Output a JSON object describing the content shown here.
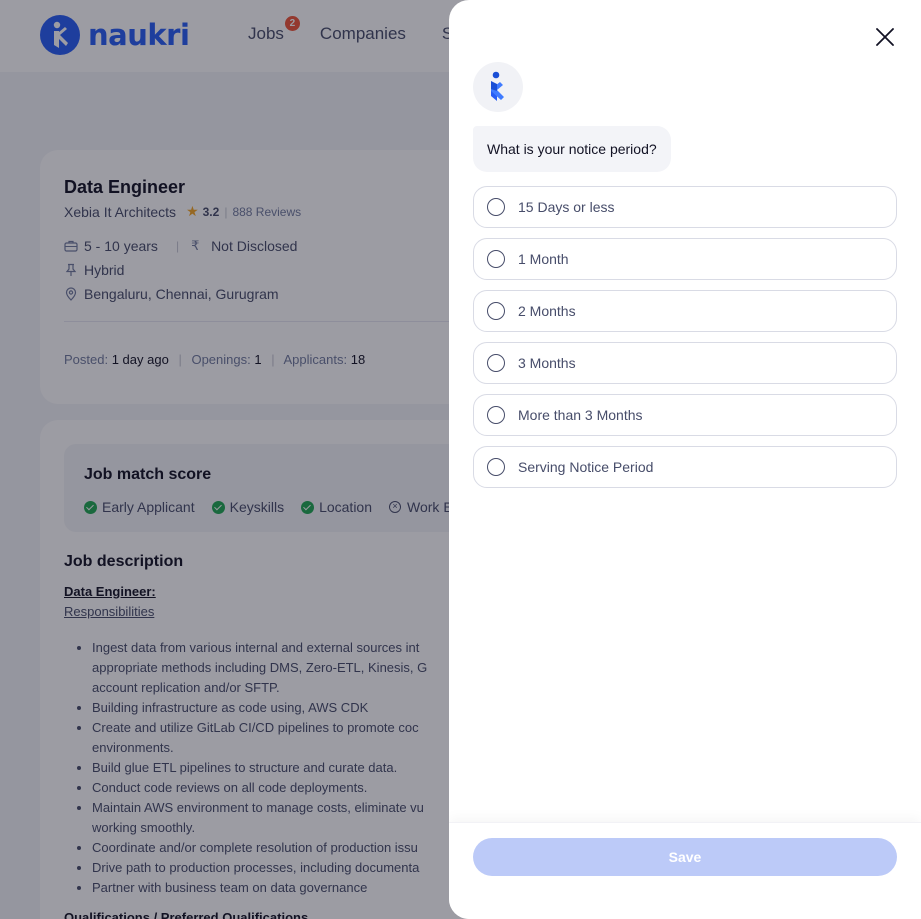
{
  "brand": {
    "name": "naukri",
    "color": "#275df5"
  },
  "nav": {
    "items": [
      {
        "label": "Jobs",
        "badge": "2"
      },
      {
        "label": "Companies"
      },
      {
        "label": "Se"
      }
    ]
  },
  "job": {
    "title": "Data Engineer",
    "company": "Xebia It Architects",
    "rating": "3.2",
    "reviews": "888 Reviews",
    "experience": "5 - 10 years",
    "salary": "Not Disclosed",
    "work_mode": "Hybrid",
    "locations": "Bengaluru, Chennai, Gurugram",
    "stats": {
      "posted_label": "Posted:",
      "posted_value": "1 day ago",
      "openings_label": "Openings:",
      "openings_value": "1",
      "applicants_label": "Applicants:",
      "applicants_value": "18"
    }
  },
  "match": {
    "title": "Job match score",
    "items": [
      {
        "label": "Early Applicant",
        "matched": true
      },
      {
        "label": "Keyskills",
        "matched": true
      },
      {
        "label": "Location",
        "matched": true
      },
      {
        "label": "Work E",
        "matched": false
      }
    ]
  },
  "description": {
    "title": "Job description",
    "subtitle": "Data Engineer:",
    "section": "Responsibilities",
    "bullets": [
      "Ingest data from various internal and external sources int appropriate methods including DMS, Zero-ETL, Kinesis, G account replication and/or SFTP.",
      "Building infrastructure as code using, AWS CDK",
      "Create and utilize GitLab CI/CD pipelines to promote coc environments.",
      "Build glue ETL pipelines to structure and curate data.",
      "Conduct code reviews on all code deployments.",
      "Maintain AWS environment to manage costs, eliminate vu working smoothly.",
      "Coordinate and/or complete resolution of production issu",
      "Drive path to production processes, including documenta",
      "Partner with business team on data governance"
    ],
    "qualifications": "Qualifications / Preferred Qualifications"
  },
  "drawer": {
    "question": "What is your notice period?",
    "options": [
      "15 Days or less",
      "1 Month",
      "2 Months",
      "3 Months",
      "More than 3 Months",
      "Serving Notice Period"
    ],
    "save_label": "Save",
    "save_color": "#bccaf8"
  },
  "icons": {
    "close": "close-icon",
    "bot": "naukri-bot-icon",
    "briefcase": "briefcase-icon",
    "rupee": "rupee-icon",
    "pin": "pushpin-icon",
    "location": "location-icon",
    "star": "star-icon"
  }
}
